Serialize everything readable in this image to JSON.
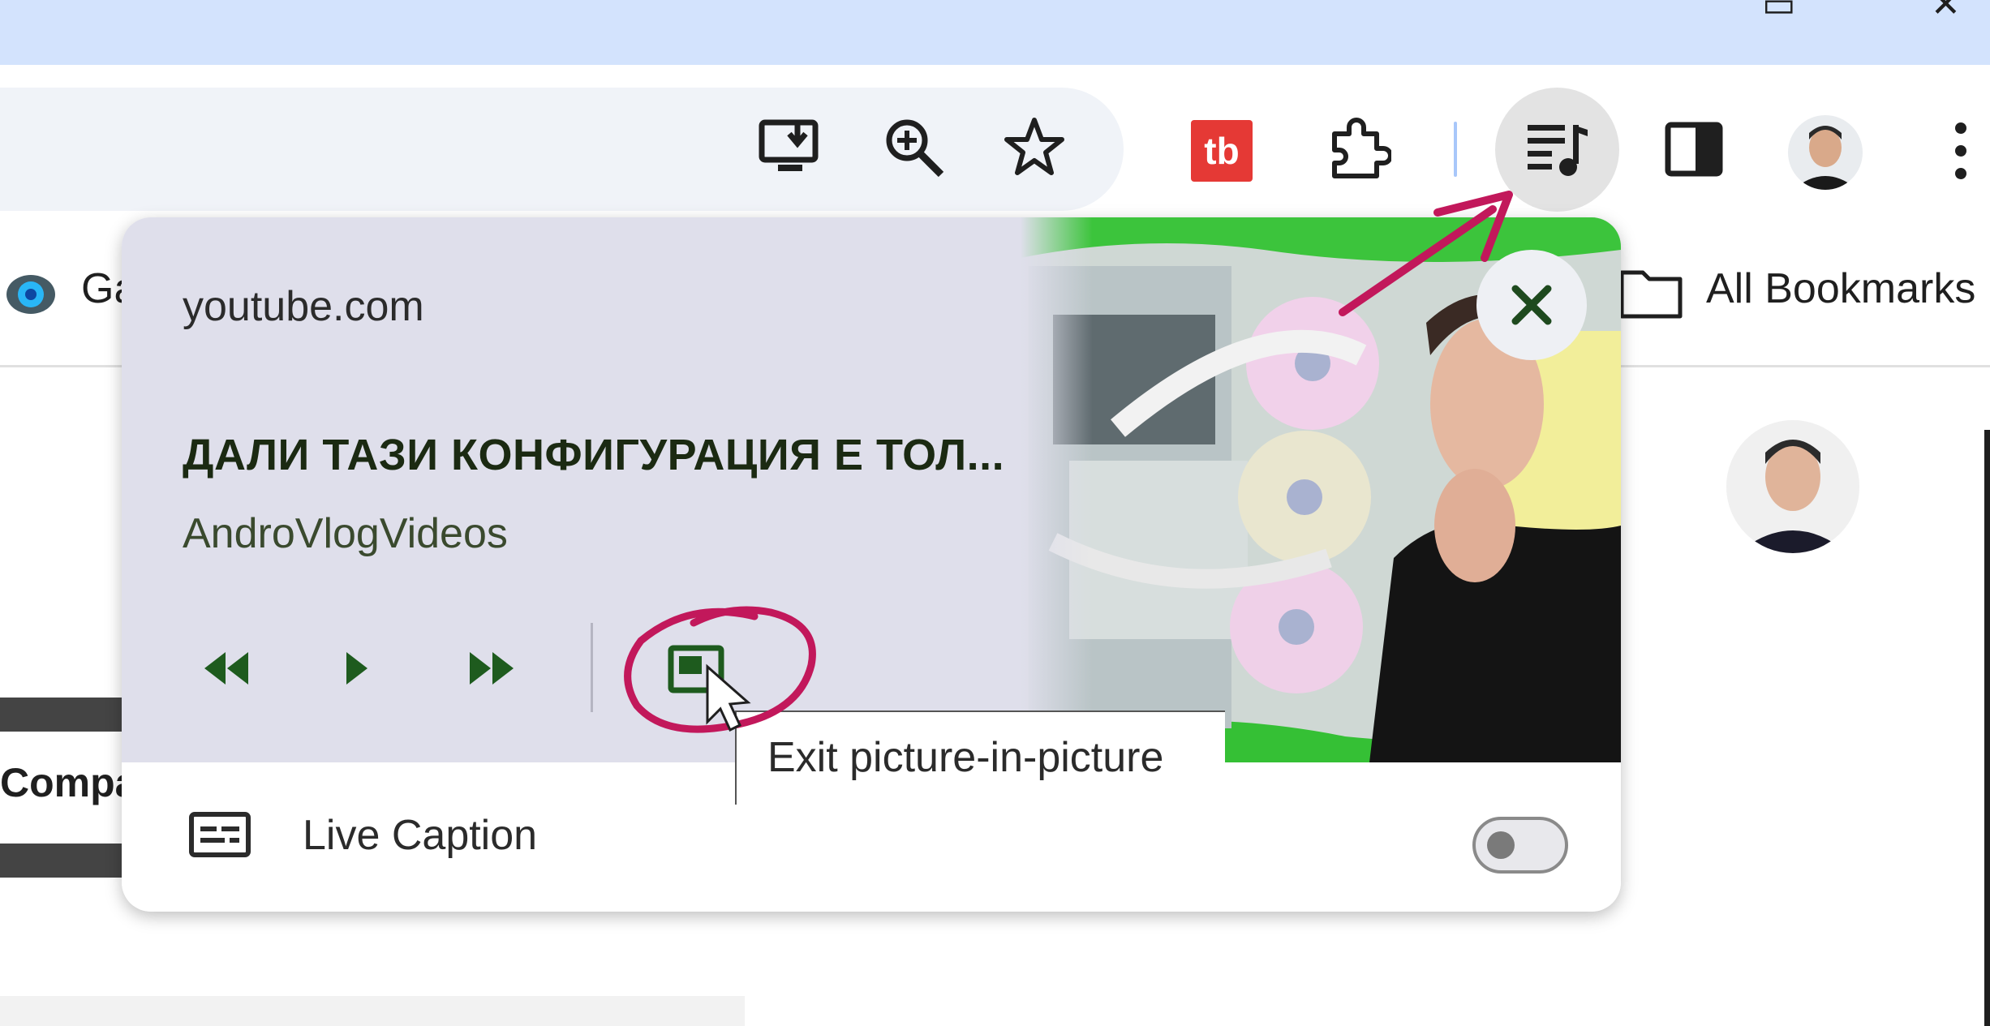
{
  "browser": {
    "window_controls": [
      "▭",
      "✕"
    ],
    "toolbar_icons": [
      "install-app-icon",
      "zoom-icon",
      "bookmark-star-icon",
      "tubebuddy-extension-icon",
      "extensions-puzzle-icon",
      "media-controls-icon",
      "side-panel-icon",
      "profile-avatar-icon",
      "more-menu-icon"
    ],
    "extension_badge_text": "tb",
    "extension_badge_color": "#e53935",
    "accent_separator_color": "#a8c7fa"
  },
  "bookmarks_bar": {
    "left_item_partial": "Ga",
    "all_bookmarks_label": "All Bookmarks"
  },
  "page": {
    "partial_button_text": "Compa"
  },
  "media_panel": {
    "site": "youtube.com",
    "title": "ДАЛИ ТАЗИ КОНФИГУРАЦИЯ Е ТОЛ...",
    "channel": "AndroVlogVideos",
    "controls": [
      "previous-track-icon",
      "play-icon",
      "next-track-icon",
      "picture-in-picture-icon"
    ],
    "live_caption_label": "Live Caption",
    "live_caption_enabled": false,
    "tooltip": "Exit picture-in-picture",
    "accent_color": "#1e5b1e",
    "annotation_color": "#c2185b"
  }
}
